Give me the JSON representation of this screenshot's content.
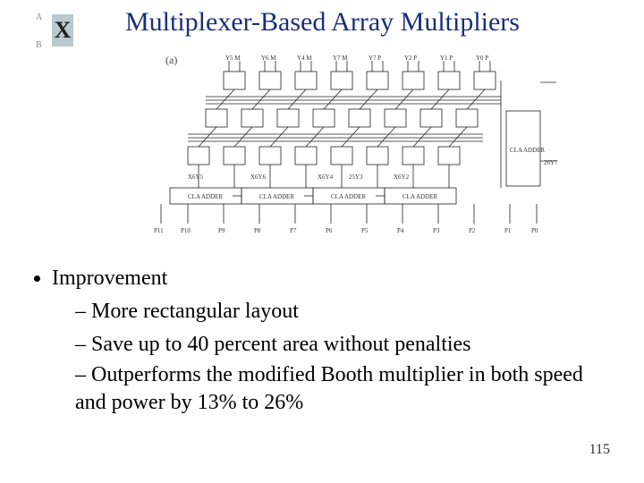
{
  "title": "Multiplexer-Based Array Multipliers",
  "logo": {
    "a": "A",
    "b": "B",
    "x": "X"
  },
  "figure": {
    "label": "(a)",
    "top_signals": [
      "Y5 M",
      "Y6 M",
      "Y7 M",
      "Y7 P",
      "Y2 P",
      "Y1 P",
      "Y0 P"
    ],
    "right_label": "26Y7",
    "bottom_inputs": [
      "X6Y5",
      "X6Y6",
      "X6Y4",
      "25Y3",
      "X6Y2"
    ],
    "adder_row": "CLA ADDER",
    "cla_sum": "CLA ADDER",
    "products": [
      "P11",
      "P10",
      "P9",
      "P8",
      "P7",
      "P6",
      "P5",
      "P4",
      "P3",
      "P2",
      "P1",
      "P0"
    ]
  },
  "bullets": {
    "top": "Improvement",
    "subs": [
      "More rectangular layout",
      "Save up to 40 percent area without penalties",
      "Outperforms the modified Booth multiplier in both speed and power by 13% to 26%"
    ]
  },
  "page": "115"
}
